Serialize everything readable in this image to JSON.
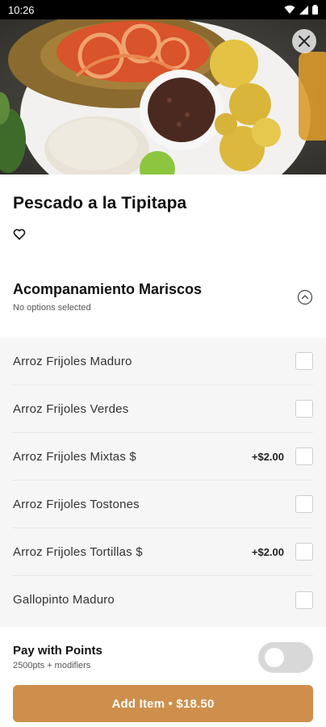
{
  "status_bar": {
    "time": "10:26"
  },
  "item": {
    "title": "Pescado a la Tipitapa"
  },
  "group": {
    "title": "Acompanamiento Mariscos",
    "subtitle": "No options selected"
  },
  "options": [
    {
      "label": "Arroz Frijoles Maduro",
      "price": ""
    },
    {
      "label": "Arroz Frijoles Verdes",
      "price": ""
    },
    {
      "label": "Arroz Frijoles Mixtas $",
      "price": "+$2.00"
    },
    {
      "label": "Arroz Frijoles Tostones",
      "price": ""
    },
    {
      "label": "Arroz Frijoles Tortillas $",
      "price": "+$2.00"
    },
    {
      "label": "Gallopinto Maduro",
      "price": ""
    }
  ],
  "points": {
    "label": "Pay with Points",
    "sub": "2500pts + modifiers",
    "enabled": false
  },
  "add_button": {
    "label": "Add Item • $18.50"
  },
  "colors": {
    "accent": "#cf8f4c"
  },
  "icons": [
    "wifi-icon",
    "signal-icon",
    "battery-icon",
    "close-icon",
    "heart-icon",
    "chevron-up-icon"
  ]
}
